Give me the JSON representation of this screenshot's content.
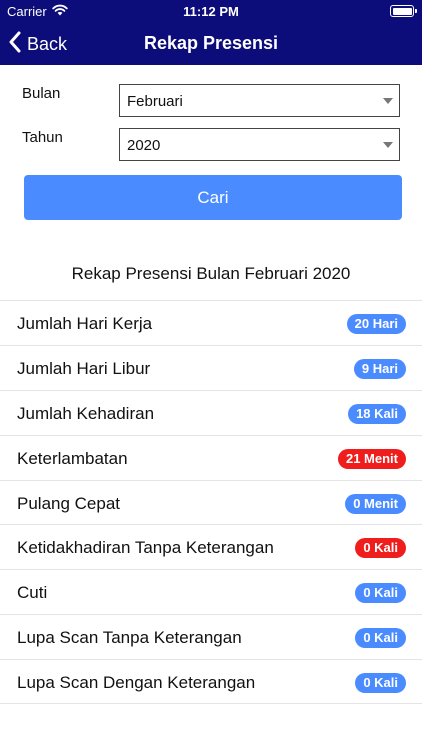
{
  "status_bar": {
    "carrier": "Carrier",
    "time": "11:12 PM",
    "wifi_icon": "wifi-icon",
    "battery_icon": "battery-icon"
  },
  "nav": {
    "back_label": "Back",
    "back_icon": "chevron-left-icon",
    "title": "Rekap Presensi",
    "bg_color": "#0c0c7a"
  },
  "filters": {
    "month": {
      "label": "Bulan",
      "value": "Februari"
    },
    "year": {
      "label": "Tahun",
      "value": "2020"
    },
    "search_label": "Cari",
    "accent_color": "#4a8cff"
  },
  "summary": {
    "title": "Rekap Presensi Bulan Februari 2020",
    "rows": [
      {
        "label": "Jumlah Hari Kerja",
        "badge": "20 Hari",
        "color": "blue"
      },
      {
        "label": "Jumlah Hari Libur",
        "badge": "9 Hari",
        "color": "blue"
      },
      {
        "label": "Jumlah Kehadiran",
        "badge": "18 Kali",
        "color": "blue"
      },
      {
        "label": "Keterlambatan",
        "badge": "21 Menit",
        "color": "red"
      },
      {
        "label": "Pulang Cepat",
        "badge": "0 Menit",
        "color": "blue"
      },
      {
        "label": "Ketidakhadiran Tanpa Keterangan",
        "badge": "0 Kali",
        "color": "red"
      },
      {
        "label": "Cuti",
        "badge": "0 Kali",
        "color": "blue"
      },
      {
        "label": "Lupa Scan Tanpa Keterangan",
        "badge": "0 Kali",
        "color": "blue"
      },
      {
        "label": "Lupa Scan Dengan Keterangan",
        "badge": "0 Kali",
        "color": "blue"
      }
    ]
  },
  "status_colors": {
    "blue": "#4a8cff",
    "red": "#f01d1d"
  }
}
